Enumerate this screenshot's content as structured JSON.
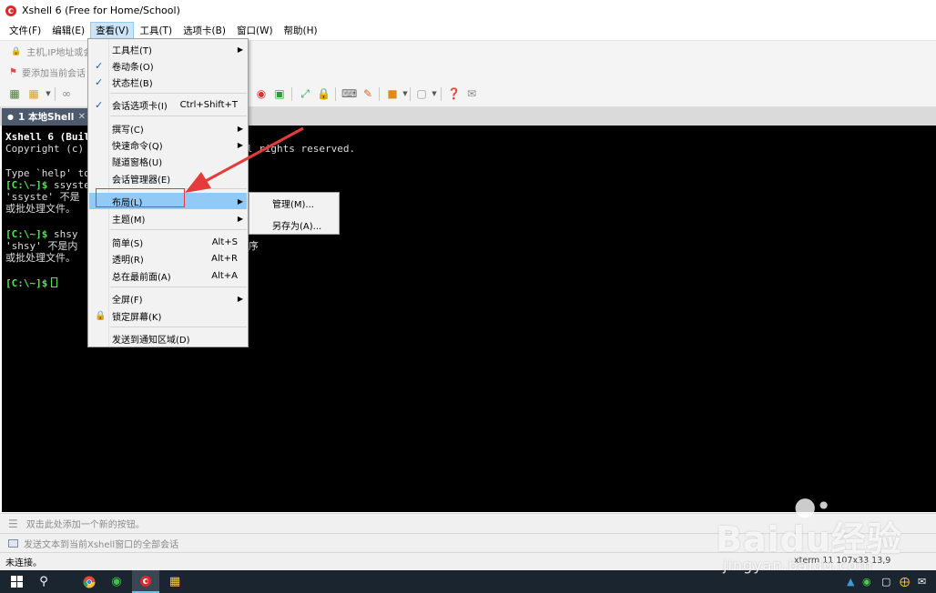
{
  "window": {
    "title": "Xshell 6 (Free for Home/School)"
  },
  "menubar": {
    "items": [
      {
        "label": "文件(F)"
      },
      {
        "label": "编辑(E)"
      },
      {
        "label": "查看(V)"
      },
      {
        "label": "工具(T)"
      },
      {
        "label": "选项卡(B)"
      },
      {
        "label": "窗口(W)"
      },
      {
        "label": "帮助(H)"
      }
    ]
  },
  "address_bar": {
    "placeholder": "主机,IP地址或会"
  },
  "links_bar": {
    "text": "要添加当前会话"
  },
  "tab": {
    "label": "1 本地Shell"
  },
  "terminal": {
    "lines": [
      {
        "prompt": "",
        "text": "Xshell 6 (Buil"
      },
      {
        "prompt": "",
        "text": "Copyright (c)                     nc. All rights reserved."
      },
      {
        "prompt": "",
        "text": ""
      },
      {
        "prompt": "",
        "text": "Type `help' to                   prompt."
      },
      {
        "prompt": "[C:\\~]$",
        "text": " ssyste"
      },
      {
        "prompt": "",
        "text": "'ssyste' 不是"
      },
      {
        "prompt": "",
        "text": "或批处理文件。"
      },
      {
        "prompt": "",
        "text": ""
      },
      {
        "prompt": "[C:\\~]$",
        "text": " shsy"
      },
      {
        "prompt": "",
        "text": "'shsy' 不是内                         的程序"
      },
      {
        "prompt": "",
        "text": "或批处理文件。"
      },
      {
        "prompt": "",
        "text": ""
      },
      {
        "prompt": "[C:\\~]$",
        "text": ""
      }
    ]
  },
  "view_menu": {
    "items": [
      {
        "label": "工具栏(T)",
        "shortcut": "",
        "submenu": true,
        "checked": false
      },
      {
        "label": "卷动条(O)",
        "shortcut": "",
        "submenu": false,
        "checked": true
      },
      {
        "label": "状态栏(B)",
        "shortcut": "",
        "submenu": false,
        "checked": true
      },
      {
        "label": "会话选项卡(I)",
        "shortcut": "Ctrl+Shift+T",
        "submenu": false,
        "checked": true
      },
      {
        "label": "撰写(C)",
        "shortcut": "",
        "submenu": true,
        "checked": false
      },
      {
        "label": "快速命令(Q)",
        "shortcut": "",
        "submenu": true,
        "checked": false
      },
      {
        "label": "隧道窗格(U)",
        "shortcut": "",
        "submenu": false,
        "checked": false
      },
      {
        "label": "会话管理器(E)",
        "shortcut": "",
        "submenu": false,
        "checked": false
      },
      {
        "label": "布局(L)",
        "shortcut": "",
        "submenu": true,
        "checked": false,
        "highlighted": true
      },
      {
        "label": "主题(M)",
        "shortcut": "",
        "submenu": true,
        "checked": false
      },
      {
        "label": "简单(S)",
        "shortcut": "Alt+S",
        "submenu": false,
        "checked": false
      },
      {
        "label": "透明(R)",
        "shortcut": "Alt+R",
        "submenu": false,
        "checked": false
      },
      {
        "label": "总在最前面(A)",
        "shortcut": "Alt+A",
        "submenu": false,
        "checked": false
      },
      {
        "label": "全屏(F)",
        "shortcut": "",
        "submenu": true,
        "checked": false
      },
      {
        "label": "锁定屏幕(K)",
        "shortcut": "",
        "submenu": false,
        "checked": false,
        "icon": "lock-icon"
      },
      {
        "label": "发送到通知区域(D)",
        "shortcut": "",
        "submenu": false,
        "checked": false
      }
    ]
  },
  "layout_submenu": {
    "items": [
      {
        "label": "管理(M)..."
      },
      {
        "label": "另存为(A)..."
      }
    ]
  },
  "quick_bar": {
    "text": "双击此处添加一个新的按钮。"
  },
  "compose_bar": {
    "text": "发送文本到当前Xshell窗口的全部会话"
  },
  "status_bar": {
    "left": "未连接。",
    "right": "xterm   11 107x33   13,9"
  },
  "watermark": {
    "logo": "Baidu经验",
    "url": "jingyan.baidu.com"
  },
  "colors": {
    "terminal_bg": "#000000",
    "prompt": "#55e455",
    "menu_highlight": "#91c9f7",
    "annotation": "#e53b3b",
    "tab_active": "#4d5a6e",
    "taskbar": "#1b2530"
  }
}
